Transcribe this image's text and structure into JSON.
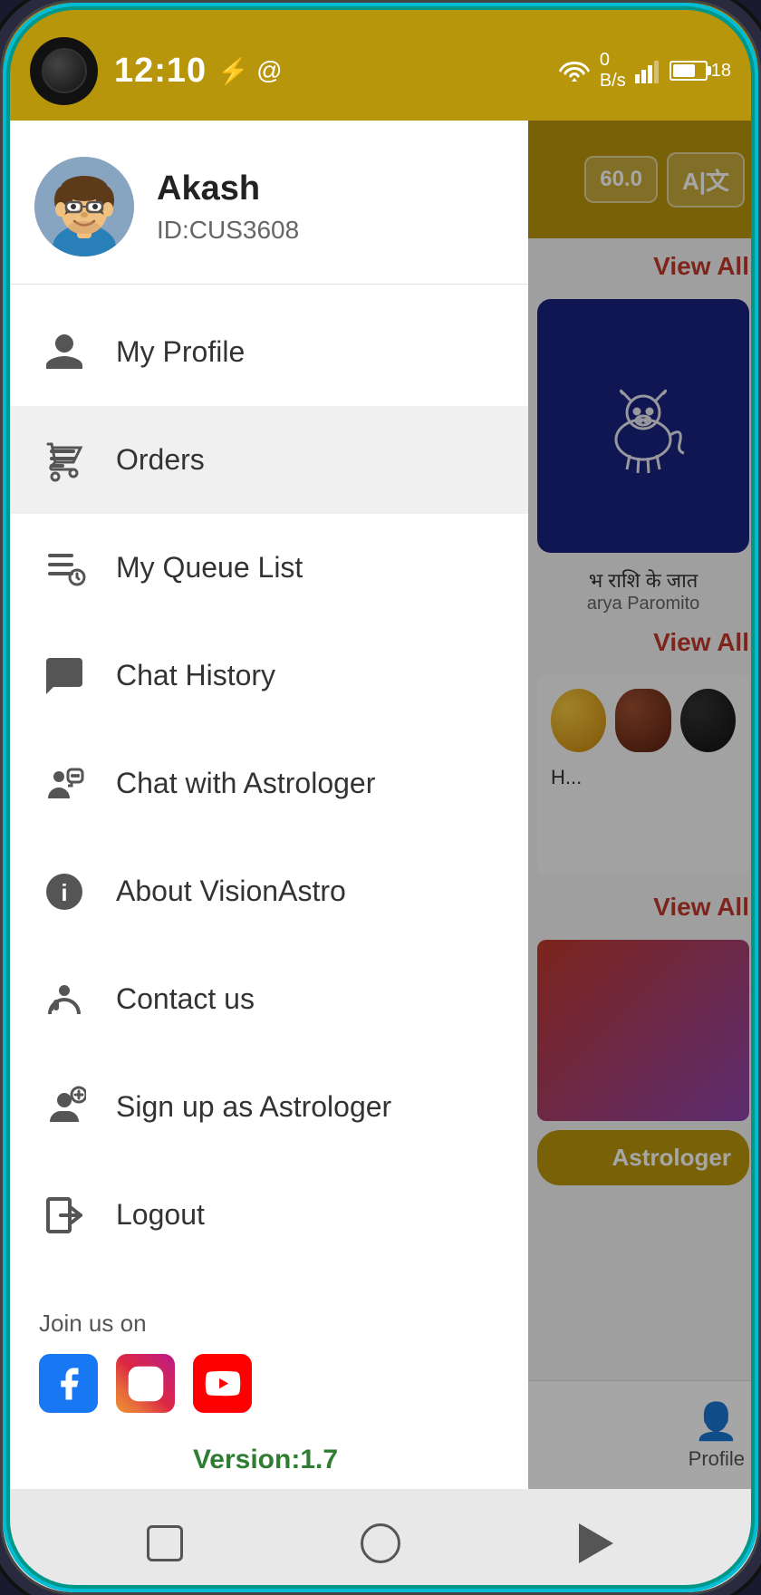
{
  "statusBar": {
    "time": "12:10",
    "usbIcon": "⚡",
    "atIcon": "@"
  },
  "user": {
    "name": "Akash",
    "id": "ID:CUS3608"
  },
  "menu": {
    "items": [
      {
        "id": "my-profile",
        "label": "My Profile",
        "icon": "person"
      },
      {
        "id": "orders",
        "label": "Orders",
        "icon": "orders"
      },
      {
        "id": "my-queue-list",
        "label": "My Queue List",
        "icon": "queue"
      },
      {
        "id": "chat-history",
        "label": "Chat History",
        "icon": "chat"
      },
      {
        "id": "chat-with-astrologer",
        "label": "Chat with Astrologer",
        "icon": "chat-astro"
      },
      {
        "id": "about-vision-astro",
        "label": "About VisionAstro",
        "icon": "info"
      },
      {
        "id": "contact-us",
        "label": "Contact us",
        "icon": "support"
      },
      {
        "id": "sign-up-as-astrologer",
        "label": "Sign up as Astrologer",
        "icon": "signup"
      },
      {
        "id": "logout",
        "label": "Logout",
        "icon": "logout"
      }
    ]
  },
  "social": {
    "join_text": "Join us on",
    "platforms": [
      "Facebook",
      "Instagram",
      "YouTube"
    ]
  },
  "version": "Version:1.7",
  "background": {
    "balance": "60.0",
    "view_all_1": "View All",
    "hindi_text": "भ राशि के जात",
    "astrologer_name": "arya Paromito",
    "view_all_2": "View All",
    "view_all_3": "View All",
    "astrologer_btn": "Astrologer",
    "profile_label": "Profile"
  },
  "systemNav": {
    "square_label": "recent",
    "circle_label": "home",
    "triangle_label": "back"
  }
}
